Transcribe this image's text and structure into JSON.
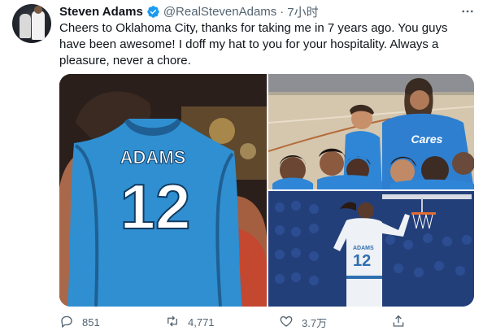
{
  "user": {
    "display_name": "Steven Adams",
    "handle": "@RealStevenAdams",
    "separator": "·",
    "time": "7小时"
  },
  "tweet": {
    "text": "Cheers to Oklahoma City, thanks for taking me in 7 years ago. You guys have been awesome! I doff my hat to you for your hospitality. Always a pleasure, never a chore."
  },
  "media": {
    "left": {
      "jersey_name": "ADAMS",
      "jersey_number": "12"
    },
    "top_right": {
      "shirt_text": "Cares"
    },
    "bottom_right": {
      "jersey_name": "ADAMS",
      "jersey_number": "12"
    }
  },
  "actions": {
    "reply": "851",
    "retweet": "4,771",
    "like": "3.7万"
  },
  "icons": {
    "verified": "verified-badge-icon",
    "more": "more-icon",
    "reply": "reply-icon",
    "retweet": "retweet-icon",
    "like": "heart-icon",
    "share": "share-icon"
  },
  "colors": {
    "verified": "#1d9bf0",
    "text": "#0f1419",
    "secondary": "#536471",
    "jersey": "#2f8fd0"
  }
}
